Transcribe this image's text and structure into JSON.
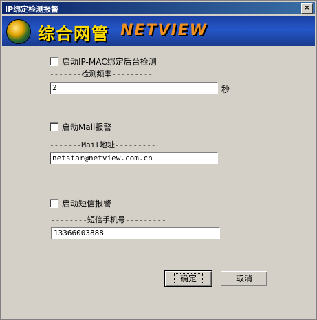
{
  "window": {
    "title": "IP绑定检测报警",
    "close_glyph": "×"
  },
  "banner": {
    "cn_text": "综合网管",
    "en_text": "NETVIEW"
  },
  "ip_mac": {
    "checkbox_label": "启动IP-MAC绑定后台检测",
    "section_header": "-------检测频率---------",
    "frequency_value": "2",
    "unit": "秒"
  },
  "mail": {
    "checkbox_label": "启动Mail报警",
    "section_header": "-------Mail地址---------",
    "address_value": "netstar@netview.com.cn"
  },
  "sms": {
    "checkbox_label": "启动短信报警",
    "section_header": "--------短信手机号---------",
    "phone_value": "13366003888"
  },
  "buttons": {
    "ok_label": "确定",
    "cancel_label": "取消"
  }
}
